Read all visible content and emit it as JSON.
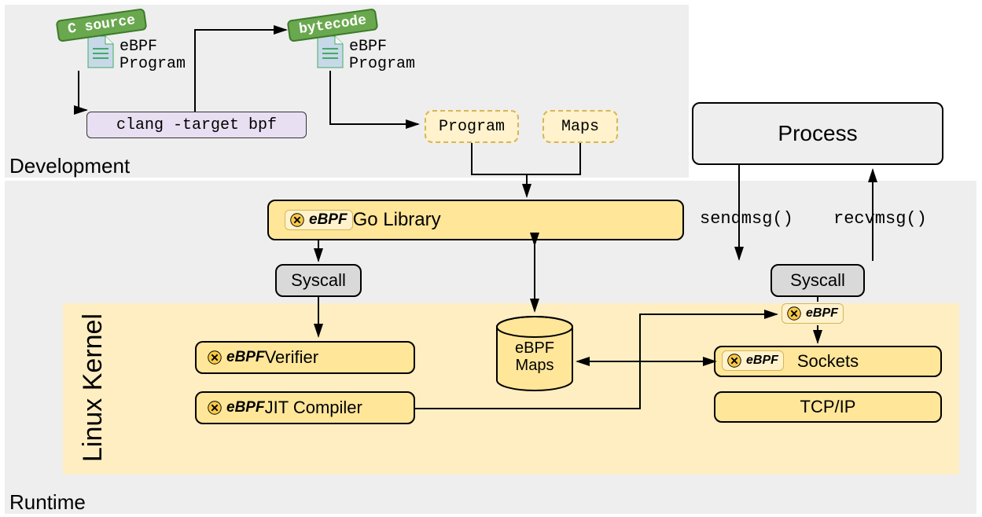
{
  "sections": {
    "development": "Development",
    "runtime": "Runtime",
    "kernel": "Linux Kernel"
  },
  "tags": {
    "csource": "C source",
    "bytecode": "bytecode"
  },
  "programs": {
    "ebpf_prog1_l1": "eBPF",
    "ebpf_prog1_l2": "Program",
    "ebpf_prog2_l1": "eBPF",
    "ebpf_prog2_l2": "Program"
  },
  "clang_cmd": "clang -target bpf",
  "dev_boxes": {
    "program": "Program",
    "maps": "Maps"
  },
  "go_library": " Go Library",
  "syscall_left": "Syscall",
  "syscall_right": "Syscall",
  "verifier": " Verifier",
  "jit": " JIT Compiler",
  "maps_cyl_l1": "eBPF",
  "maps_cyl_l2": "Maps",
  "sockets": "Sockets",
  "tcpip": "TCP/IP",
  "process": "Process",
  "sendmsg": "sendmsg()",
  "recvmsg": "recvmsg()",
  "ebpf_word": "eBPF",
  "chart_data": {
    "type": "diagram",
    "nodes": [
      {
        "id": "csource",
        "label": "C source eBPF Program"
      },
      {
        "id": "clang",
        "label": "clang -target bpf"
      },
      {
        "id": "bytecode",
        "label": "bytecode eBPF Program"
      },
      {
        "id": "program",
        "label": "Program"
      },
      {
        "id": "maps",
        "label": "Maps"
      },
      {
        "id": "golib",
        "label": "eBPF Go Library"
      },
      {
        "id": "syscall1",
        "label": "Syscall"
      },
      {
        "id": "verifier",
        "label": "eBPF Verifier"
      },
      {
        "id": "jit",
        "label": "eBPF JIT Compiler"
      },
      {
        "id": "ebpfmaps",
        "label": "eBPF Maps"
      },
      {
        "id": "process",
        "label": "Process"
      },
      {
        "id": "syscall2",
        "label": "Syscall"
      },
      {
        "id": "ebpf_hook1",
        "label": "eBPF"
      },
      {
        "id": "sockets",
        "label": "Sockets"
      },
      {
        "id": "ebpf_hook2",
        "label": "eBPF"
      },
      {
        "id": "tcpip",
        "label": "TCP/IP"
      }
    ],
    "edges": [
      {
        "from": "csource",
        "to": "clang"
      },
      {
        "from": "clang",
        "to": "bytecode"
      },
      {
        "from": "bytecode",
        "to": "program"
      },
      {
        "from": "program",
        "to": "golib"
      },
      {
        "from": "maps",
        "to": "golib"
      },
      {
        "from": "golib",
        "to": "syscall1"
      },
      {
        "from": "syscall1",
        "to": "verifier"
      },
      {
        "from": "verifier",
        "to": "jit"
      },
      {
        "from": "golib",
        "to": "ebpfmaps",
        "bidirectional": true
      },
      {
        "from": "jit",
        "to": "ebpfmaps"
      },
      {
        "from": "jit",
        "to": "ebpf_hook1"
      },
      {
        "from": "jit",
        "to": "ebpf_hook2"
      },
      {
        "from": "process",
        "to": "syscall2",
        "label": "sendmsg()"
      },
      {
        "from": "syscall2",
        "to": "process",
        "label": "recvmsg()"
      },
      {
        "from": "syscall2",
        "to": "ebpf_hook1"
      },
      {
        "from": "ebpf_hook1",
        "to": "sockets"
      },
      {
        "from": "sockets",
        "to": "tcpip"
      }
    ],
    "regions": [
      {
        "id": "development",
        "contains": [
          "csource",
          "clang",
          "bytecode",
          "program",
          "maps"
        ]
      },
      {
        "id": "runtime",
        "contains": [
          "golib",
          "syscall1",
          "verifier",
          "jit",
          "ebpfmaps",
          "process",
          "syscall2",
          "ebpf_hook1",
          "ebpf_hook2",
          "sockets",
          "tcpip"
        ]
      },
      {
        "id": "kernel",
        "contains": [
          "verifier",
          "jit",
          "ebpfmaps",
          "ebpf_hook1",
          "ebpf_hook2",
          "sockets",
          "tcpip"
        ]
      }
    ]
  }
}
